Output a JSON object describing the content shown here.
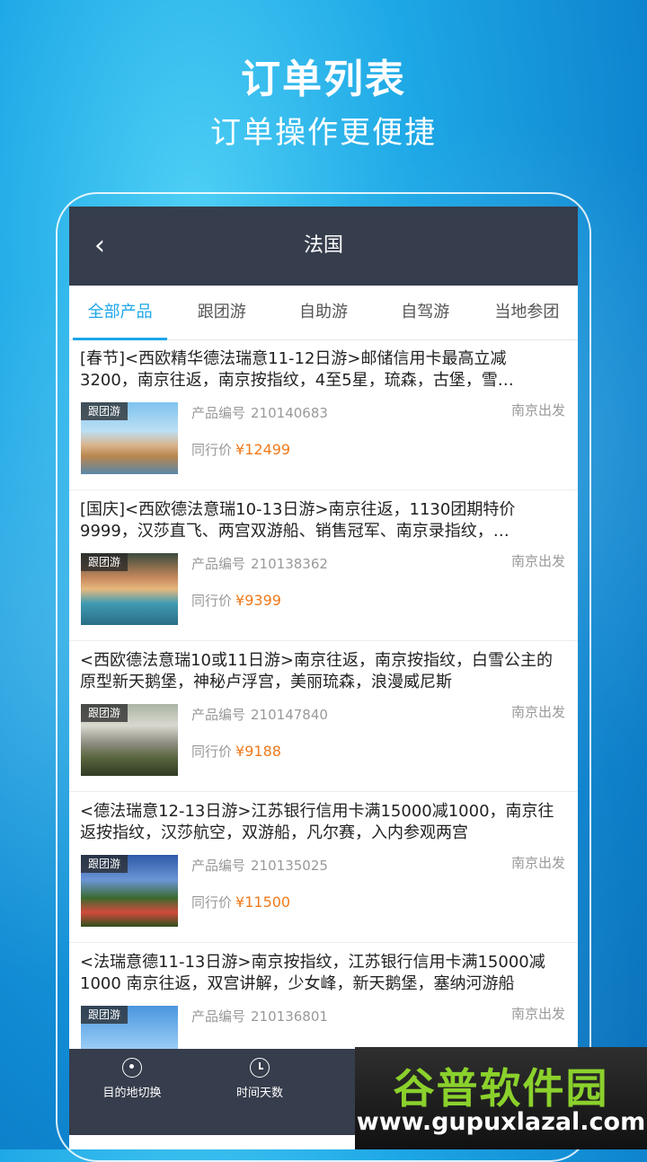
{
  "hero": {
    "title": "订单列表",
    "subtitle": "订单操作更便捷"
  },
  "nav": {
    "back_icon": "chevron-left-icon",
    "title": "法国"
  },
  "tabs": [
    {
      "label": "全部产品",
      "active": true
    },
    {
      "label": "跟团游",
      "active": false
    },
    {
      "label": "自助游",
      "active": false
    },
    {
      "label": "自驾游",
      "active": false
    },
    {
      "label": "当地参团",
      "active": false
    }
  ],
  "list": {
    "code_label": "产品编号",
    "price_label": "同行价",
    "currency": "¥",
    "items": [
      {
        "title": "[春节]<西欧精华德法瑞意11-12日游>邮储信用卡最高立减3200，南京往返，南京按指纹，4至5星，琉森，古堡，雪…",
        "tag": "跟团游",
        "code": "210140683",
        "depart": "南京出发",
        "price": "12499"
      },
      {
        "title": "[国庆]<西欧德法意瑞10-13日游>南京往返，1130团期特价9999，汉莎直飞、两宫双游船、销售冠军、南京录指纹，…",
        "tag": "跟团游",
        "code": "210138362",
        "depart": "南京出发",
        "price": "9399"
      },
      {
        "title": "<西欧德法意瑞10或11日游>南京往返，南京按指纹，白雪公主的原型新天鹅堡，神秘卢浮宫，美丽琉森，浪漫威尼斯",
        "tag": "跟团游",
        "code": "210147840",
        "depart": "南京出发",
        "price": "9188"
      },
      {
        "title": "<德法瑞意12-13日游>江苏银行信用卡满15000减1000，南京往返按指纹，汉莎航空，双游船，凡尔赛，入内参观两宫",
        "tag": "跟团游",
        "code": "210135025",
        "depart": "南京出发",
        "price": "11500"
      },
      {
        "title": "<法瑞意德11-13日游>南京按指纹，江苏银行信用卡满15000减1000 南京往返，双宫讲解，少女峰，新天鹅堡，塞纳河游船",
        "tag": "跟团游",
        "code": "210136801",
        "depart": "南京出发",
        "price": ""
      }
    ]
  },
  "bottom_bar": [
    {
      "label": "目的地切换",
      "icon": "location-pin-icon"
    },
    {
      "label": "时间天数",
      "icon": "clock-icon"
    }
  ],
  "watermark": {
    "text": "谷普软件园",
    "url": "www.gupuxlazal.com"
  },
  "colors": {
    "accent": "#1da6e8",
    "nav_bg": "#363d4c",
    "price": "#f07a1c"
  }
}
